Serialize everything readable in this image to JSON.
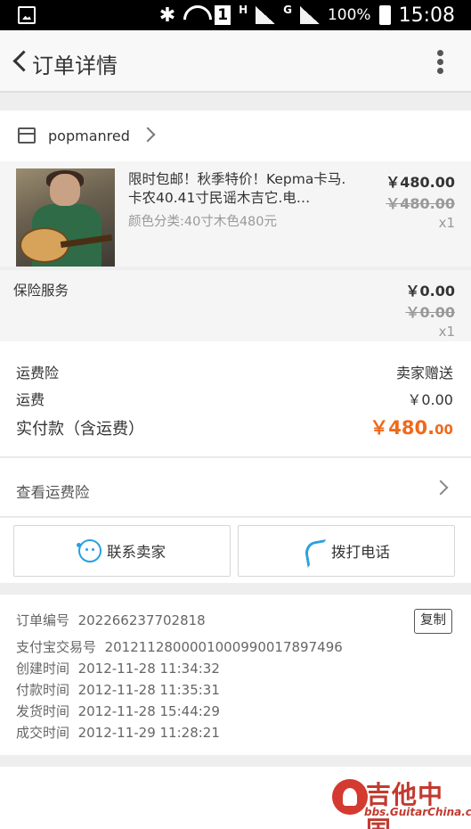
{
  "statusbar": {
    "net_h": "H",
    "sim": "1",
    "net_g": "G",
    "battery": "100%",
    "time": "15:08"
  },
  "header": {
    "title": "订单详情"
  },
  "shop": {
    "name": "popmanred"
  },
  "item": {
    "title": "限时包邮！秋季特价！Kepma卡马.卡农40.41寸民谣木吉它.电…",
    "sku": "颜色分类:40寸木色480元",
    "price": "￥480.00",
    "original_price": "￥480.00",
    "qty": "x1"
  },
  "insurance": {
    "label": "保险服务",
    "price": "￥0.00",
    "original_price": "￥0.00",
    "qty": "x1"
  },
  "summary": {
    "freight_insurance_label": "运费险",
    "freight_insurance_value": "卖家赠送",
    "freight_label": "运费",
    "freight_value": "￥0.00",
    "paid_label": "实付款（含运费）",
    "paid_int": "￥480.",
    "paid_dec": "00"
  },
  "freight_link": {
    "label": "查看运费险"
  },
  "actions": {
    "contact_label": "联系卖家",
    "call_label": "拨打电话"
  },
  "order_info": {
    "order_no_label": "订单编号",
    "order_no": "202266237702818",
    "copy_label": "复制",
    "alipay_label": "支付宝交易号",
    "alipay_no": "2012112800001000990017897496",
    "created_label": "创建时间",
    "created": "2012-11-28 11:34:32",
    "paid_label": "付款时间",
    "paid": "2012-11-28 11:35:31",
    "shipped_label": "发货时间",
    "shipped": "2012-11-28 15:44:29",
    "closed_label": "成交时间",
    "closed": "2012-11-29 11:28:21"
  },
  "watermark": {
    "text": "吉他中国",
    "url": "bbs.GuitarChina.com"
  },
  "colors": {
    "accent": "#f06a1a",
    "icon_blue": "#2aa0e0"
  }
}
